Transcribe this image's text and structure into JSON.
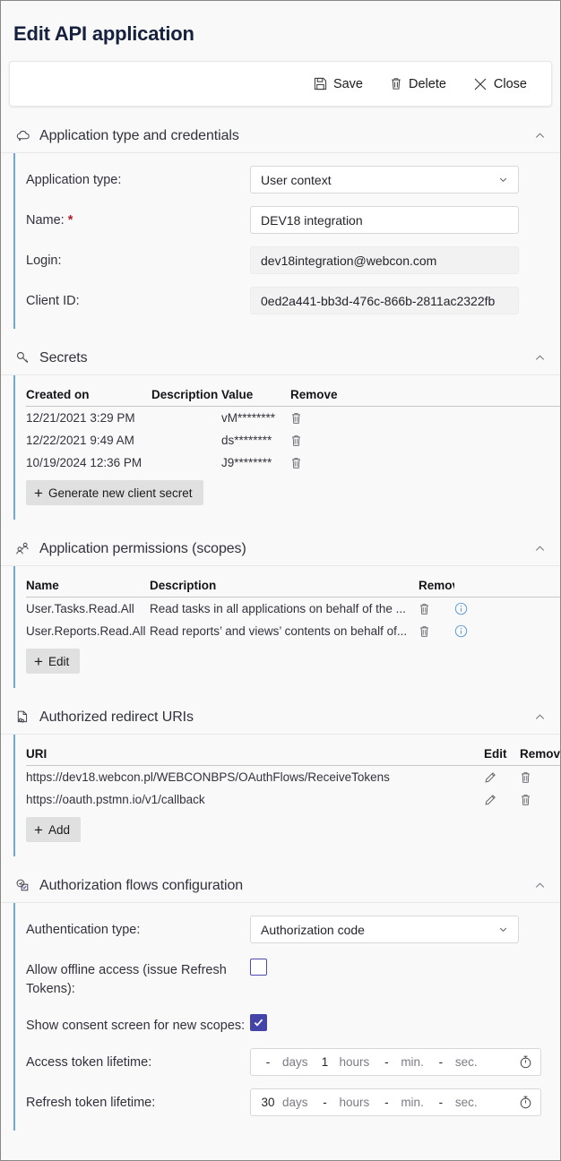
{
  "page": {
    "title": "Edit API application"
  },
  "toolbar": {
    "save": {
      "label": "Save",
      "icon": "save-icon"
    },
    "delete": {
      "label": "Delete",
      "icon": "trash-icon"
    },
    "close": {
      "label": "Close",
      "icon": "close-icon"
    }
  },
  "sections": {
    "app_type": {
      "title": "Application type and credentials",
      "icon": "cloud-app-icon",
      "collapse_icon": "chevron-up-icon",
      "fields": {
        "application_type": {
          "label": "Application type:",
          "value": "User context",
          "chevron": "chevron-down-icon"
        },
        "name": {
          "label": "Name:",
          "required_marker": "*",
          "value": "DEV18 integration"
        },
        "login": {
          "label": "Login:",
          "value": "dev18integration@webcon.com"
        },
        "client_id": {
          "label": "Client ID:",
          "value": "0ed2a441-bb3d-476c-866b-2811ac2322fb"
        }
      }
    },
    "secrets": {
      "title": "Secrets",
      "icon": "key-icon",
      "collapse_icon": "chevron-up-icon",
      "columns": [
        "Created on",
        "Description",
        "Value",
        "Remove"
      ],
      "rows": [
        {
          "created_on": "12/21/2021 3:29 PM",
          "description": "",
          "value": "vM********",
          "remove_icon": "trash-icon"
        },
        {
          "created_on": "12/22/2021 9:49 AM",
          "description": "",
          "value": "ds********",
          "remove_icon": "trash-icon"
        },
        {
          "created_on": "10/19/2024 12:36 PM",
          "description": "",
          "value": "J9********",
          "remove_icon": "trash-icon"
        }
      ],
      "add_button": {
        "label": "Generate new client secret",
        "icon": "plus-icon"
      }
    },
    "permissions": {
      "title": "Application permissions (scopes)",
      "icon": "people-icon",
      "collapse_icon": "chevron-up-icon",
      "columns": [
        "Name",
        "Description",
        "Remove"
      ],
      "rows": [
        {
          "name": "User.Tasks.Read.All",
          "description": "Read tasks in all applications on behalf of the ...",
          "remove_icon": "trash-icon",
          "info_icon": "info-icon"
        },
        {
          "name": "User.Reports.Read.All",
          "description": "Read reports’ and views’ contents on behalf of...",
          "remove_icon": "trash-icon",
          "info_icon": "info-icon"
        }
      ],
      "add_button": {
        "label": "Edit",
        "icon": "plus-icon"
      }
    },
    "redirect_uris": {
      "title": "Authorized redirect URIs",
      "icon": "document-link-icon",
      "collapse_icon": "chevron-up-icon",
      "columns": [
        "URI",
        "Edit",
        "Remove"
      ],
      "rows": [
        {
          "uri": "https://dev18.webcon.pl/WEBCONBPS/OAuthFlows/ReceiveTokens",
          "edit_icon": "pencil-icon",
          "remove_icon": "trash-icon"
        },
        {
          "uri": "https://oauth.pstmn.io/v1/callback",
          "edit_icon": "pencil-icon",
          "remove_icon": "trash-icon"
        }
      ],
      "add_button": {
        "label": "Add",
        "icon": "plus-icon"
      }
    },
    "auth_flows": {
      "title": "Authorization flows configuration",
      "icon": "checkbox-check-icon",
      "collapse_icon": "chevron-up-icon",
      "fields": {
        "authentication_type": {
          "label": "Authentication type:",
          "value": "Authorization code",
          "chevron": "chevron-down-icon"
        },
        "allow_offline_access": {
          "label": "Allow offline access (issue Refresh Tokens):",
          "checked": false
        },
        "show_consent_screen": {
          "label": "Show consent screen for new scopes:",
          "checked": true
        },
        "access_token_lifetime": {
          "label": "Access token lifetime:",
          "days": "-",
          "days_unit": "days",
          "hours": "1",
          "hours_unit": "hours",
          "minutes": "-",
          "minutes_unit": "min.",
          "seconds": "-",
          "seconds_unit": "sec.",
          "clock_icon": "stopwatch-icon"
        },
        "refresh_token_lifetime": {
          "label": "Refresh token lifetime:",
          "days": "30",
          "days_unit": "days",
          "hours": "-",
          "hours_unit": "hours",
          "minutes": "-",
          "minutes_unit": "min.",
          "seconds": "-",
          "seconds_unit": "sec.",
          "clock_icon": "stopwatch-icon"
        }
      }
    }
  },
  "colors": {
    "accent_bar": "#6fa8dc",
    "checkbox_accent": "#4343a8",
    "required": "#b11b2b",
    "info_icon": "#5b9bd5",
    "title": "#16213e"
  }
}
